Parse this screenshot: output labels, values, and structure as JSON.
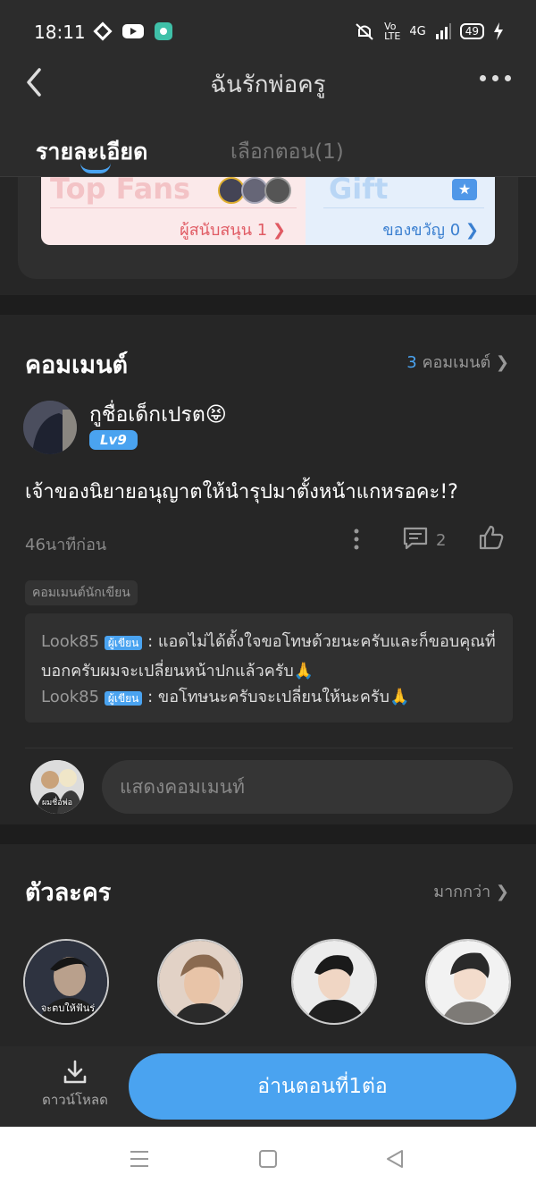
{
  "status": {
    "time": "18:11",
    "battery": "49",
    "network": "4G"
  },
  "header": {
    "title": "ฉันรักพ่อครู",
    "tab_details": "รายละเอียด",
    "tab_chapters": "เลือกตอน(1)"
  },
  "fans": {
    "top_fans_label": "Top Fans",
    "supporters": "ผู้สนับสนุน 1",
    "gift_label": "Gift",
    "gifts": "ของขวัญ 0"
  },
  "comments": {
    "title": "คอมเมนต์",
    "count": "3",
    "count_label": "คอมเมนต์",
    "item": {
      "username": "กูชื่อเด็กเปรต😝",
      "level": "Lv9",
      "text": "เจ้าของนิยายอนุญาตให้นำรุปมาตั้งหน้าแกหรอคะ!?",
      "time": "46นาทีก่อน",
      "reply_count": "2"
    },
    "author_tag": "คอมเมนต์นักเขียน",
    "replies": [
      {
        "name": "Look85",
        "badge": "ผู้เขียน",
        "text": ": แอดไม่ได้ตั้งใจขอโทษด้วยนะครับและก็ขอบคุณที่บอกครับผมจะเปลี่ยนหน้าปกแล้วครับ🙏"
      },
      {
        "name": "Look85",
        "badge": "ผู้เขียน",
        "text": ": ขอโทษนะครับจะเปลี่ยนให้นะครับ🙏"
      }
    ],
    "input_placeholder": "แสดงคอมเมนท์",
    "my_avatar_text": "ผมชื่อพ่อ"
  },
  "characters": {
    "title": "ตัวละคร",
    "more": "มากกว่า",
    "first_caption": "จะตบให้ฟันร่"
  },
  "bottom": {
    "download": "ดาวน์โหลด",
    "read_button": "อ่านตอนที่1ต่อ"
  },
  "colors": {
    "accent": "#4aa3f0",
    "bg": "#262626"
  }
}
